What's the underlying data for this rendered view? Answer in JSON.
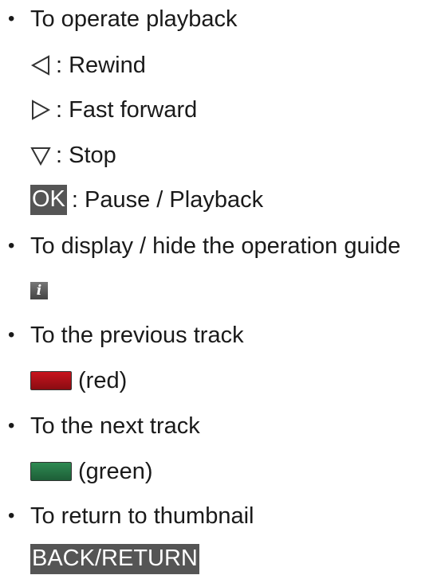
{
  "bullet_glyph": "•",
  "items": [
    {
      "label": "To operate playback",
      "controls": [
        {
          "icon": "rewind-triangle-left-icon",
          "text": ": Rewind"
        },
        {
          "icon": "fast-forward-triangle-right-icon",
          "text": ": Fast forward"
        },
        {
          "icon": "stop-triangle-down-icon",
          "text": ": Stop"
        },
        {
          "key": "OK",
          "text": ": Pause / Playback"
        }
      ]
    },
    {
      "label": "To display / hide the operation guide",
      "icon": "info-icon",
      "icon_glyph": "i"
    },
    {
      "label": "To the previous track",
      "button_color": "#c8141e",
      "button_text": "(red)"
    },
    {
      "label": "To the next track",
      "button_color": "#2e8a52",
      "button_text": "(green)"
    },
    {
      "label": "To return to thumbnail",
      "key": "BACK/RETURN"
    }
  ]
}
